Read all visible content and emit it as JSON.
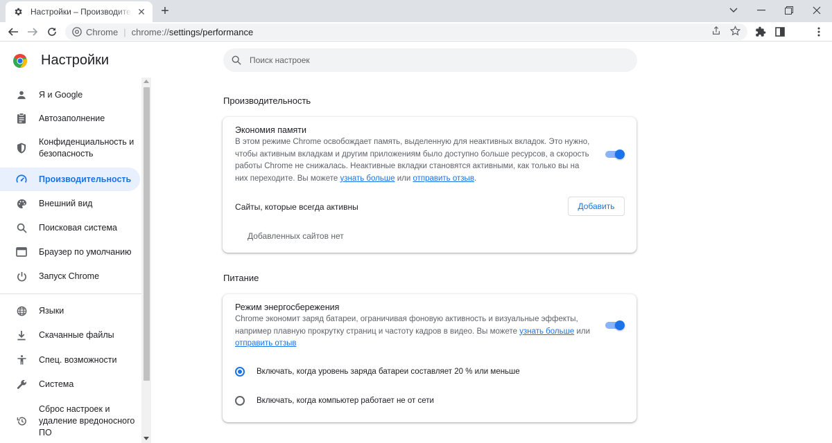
{
  "browser": {
    "tab_title": "Настройки – Производительность",
    "new_tab_label": "+",
    "omnibox_chip": "Chrome",
    "url_scheme": "chrome://",
    "url_rest": "settings/performance"
  },
  "header": {
    "title": "Настройки",
    "search_placeholder": "Поиск настроек"
  },
  "sidebar": {
    "items": [
      {
        "label": "Я и Google",
        "icon": "person-icon"
      },
      {
        "label": "Автозаполнение",
        "icon": "clipboard-icon"
      },
      {
        "label": "Конфиденциальность и безопасность",
        "icon": "shield-icon"
      },
      {
        "label": "Производительность",
        "icon": "speedometer-icon",
        "active": true
      },
      {
        "label": "Внешний вид",
        "icon": "palette-icon"
      },
      {
        "label": "Поисковая система",
        "icon": "search-icon"
      },
      {
        "label": "Браузер по умолчанию",
        "icon": "browser-icon"
      },
      {
        "label": "Запуск Chrome",
        "icon": "power-icon"
      },
      {
        "label": "Языки",
        "icon": "globe-icon"
      },
      {
        "label": "Скачанные файлы",
        "icon": "download-icon"
      },
      {
        "label": "Спец. возможности",
        "icon": "accessibility-icon"
      },
      {
        "label": "Система",
        "icon": "wrench-icon"
      },
      {
        "label": "Сброс настроек и удаление вредоносного ПО",
        "icon": "restore-icon"
      }
    ]
  },
  "performance": {
    "section_title": "Производительность",
    "memory_saver": {
      "title": "Экономия памяти",
      "description": "В этом режиме Chrome освобождает память, выделенную для неактивных вкладок. Это нужно, чтобы активным вкладкам и другим приложениям было доступно больше ресурсов, а скорость работы Chrome не снижалась. Неактивные вкладки становятся активными, как только вы на них переходите. Вы можете",
      "learn_more": "узнать больше",
      "or": "или",
      "feedback": "отправить отзыв",
      "enabled": true
    },
    "always_active": {
      "label": "Сайты, которые всегда активны",
      "add_button": "Добавить",
      "empty": "Добавленных сайтов нет"
    }
  },
  "power": {
    "section_title": "Питание",
    "energy_saver": {
      "title": "Режим энергосбережения",
      "description": "Chrome экономит заряд батареи, ограничивая фоновую активность и визуальные эффекты, например плавную прокрутку страниц и частоту кадров в видео. Вы можете",
      "learn_more": "узнать больше",
      "or": "или",
      "feedback": "отправить отзыв",
      "enabled": true
    },
    "options": [
      {
        "label": "Включать, когда уровень заряда батареи составляет 20 % или меньше",
        "checked": true
      },
      {
        "label": "Включать, когда компьютер работает не от сети",
        "checked": false
      }
    ]
  },
  "colors": {
    "accent": "#1a73e8",
    "toggle_track": "#8ab4f8",
    "active_nav_bg": "#e8f0fe"
  }
}
